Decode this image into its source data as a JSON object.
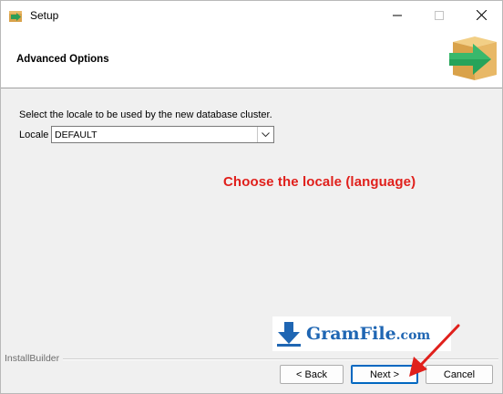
{
  "window": {
    "title": "Setup",
    "controls": [
      "minimize-icon",
      "maximize-icon",
      "close-icon"
    ]
  },
  "header": {
    "title": "Advanced Options",
    "icon": "install-box-arrow-icon"
  },
  "content": {
    "description": "Select the locale to be used by the new database cluster.",
    "locale_label": "Locale",
    "locale_value": "DEFAULT"
  },
  "annotation": {
    "text": "Choose the locale (language)",
    "color": "#e0201c"
  },
  "watermark": {
    "text": "GramFile",
    "suffix": ".com",
    "color": "#1f66b3"
  },
  "footer": {
    "brand": "InstallBuilder",
    "back_label": "< Back",
    "next_label": "Next >",
    "cancel_label": "Cancel"
  }
}
